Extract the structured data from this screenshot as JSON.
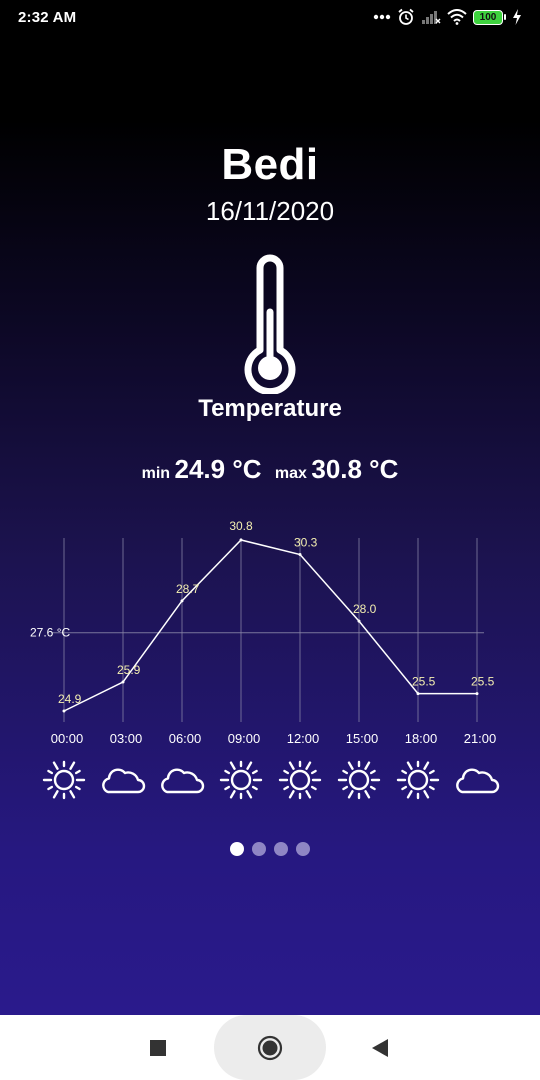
{
  "status": {
    "time": "2:32 AM",
    "battery": "100"
  },
  "location": {
    "city": "Bedi",
    "date": "16/11/2020"
  },
  "metric": {
    "label": "Temperature",
    "icon": "thermometer-icon"
  },
  "summary": {
    "min_label": "min",
    "min_value": "24.9 °C",
    "max_label": "max",
    "max_value": "30.8 °C"
  },
  "chart_data": {
    "type": "line",
    "x": [
      "00:00",
      "03:00",
      "06:00",
      "09:00",
      "12:00",
      "15:00",
      "18:00",
      "21:00"
    ],
    "values": [
      24.9,
      25.9,
      28.7,
      30.8,
      30.3,
      28.0,
      25.5,
      25.5
    ],
    "value_labels": [
      "24.9",
      "25.9",
      "28.7",
      "30.8",
      "30.3",
      "28.0",
      "25.5",
      "25.5"
    ],
    "average_line": {
      "value": 27.6,
      "label": "27.6 °C"
    },
    "ylim": [
      24.9,
      30.8
    ],
    "grid": "vertical",
    "line_color": "#ffffff"
  },
  "forecast_icons": [
    "sun-icon",
    "cloud-icon",
    "cloud-icon",
    "sun-icon",
    "sun-icon",
    "sun-icon",
    "sun-icon",
    "cloud-icon"
  ],
  "pager": {
    "pages": 4,
    "active": 1
  },
  "colors": {
    "background_top": "#000000",
    "background_bottom": "#2a1a8c",
    "battery": "#3ed23e"
  }
}
